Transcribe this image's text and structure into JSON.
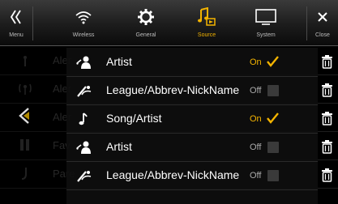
{
  "tabs": {
    "menu": {
      "label": "Menu"
    },
    "wireless": {
      "label": "Wireless"
    },
    "general": {
      "label": "General"
    },
    "source": {
      "label": "Source"
    },
    "system": {
      "label": "System"
    },
    "close": {
      "label": "Close"
    }
  },
  "background_rows": [
    {
      "text": "Aler",
      "icon": "antenna-icon"
    },
    {
      "text": "Aler",
      "icon": "antenna-icon"
    },
    {
      "text": "Aler",
      "icon": "back-arrow-icon"
    },
    {
      "text": "Fav",
      "icon": "people-icon"
    },
    {
      "text": "Pare",
      "icon": "hand-icon"
    }
  ],
  "popup_rows": [
    {
      "label": "Artist",
      "icon": "artist-icon",
      "state": "On",
      "checked": true
    },
    {
      "label": "League/Abbrev-NickName",
      "icon": "sports-icon",
      "state": "Off",
      "checked": false
    },
    {
      "label": "Song/Artist",
      "icon": "music-note-icon",
      "state": "On",
      "checked": true
    },
    {
      "label": "Artist",
      "icon": "artist-icon",
      "state": "Off",
      "checked": false
    },
    {
      "label": "League/Abbrev-NickName",
      "icon": "sports-icon",
      "state": "Off",
      "checked": false
    }
  ],
  "colors": {
    "accent": "#f4b400",
    "background": "#000000",
    "popup": "#0e0e0e"
  }
}
